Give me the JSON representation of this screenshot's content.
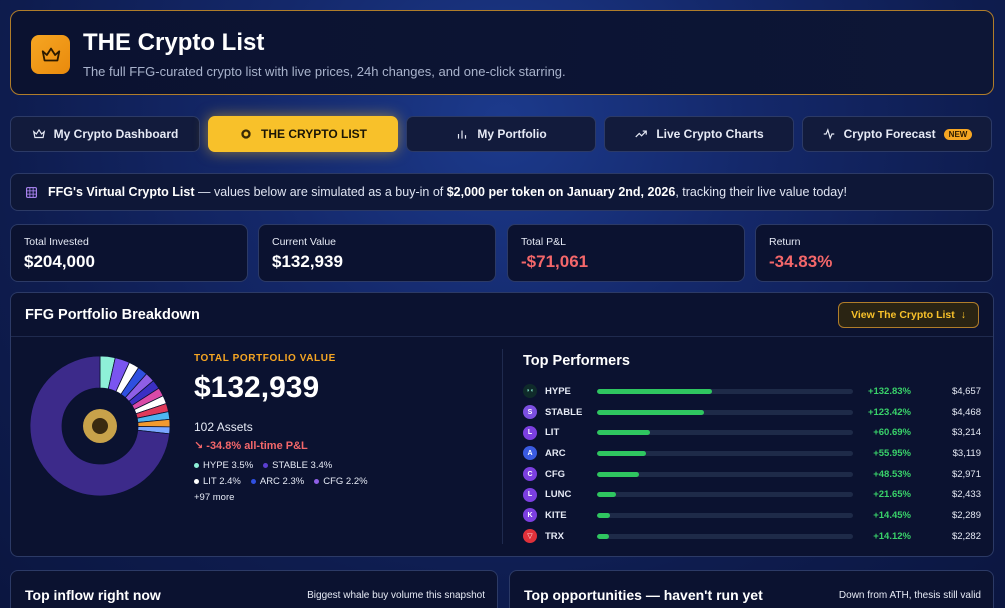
{
  "header": {
    "title": "THE Crypto List",
    "subtitle": "The full FFG-curated crypto list with live prices, 24h changes, and one-click starring.",
    "logo_icon": "crown-icon"
  },
  "tabs": [
    {
      "label": "My Crypto Dashboard",
      "icon": "crown-icon",
      "active": false
    },
    {
      "label": "THE CRYPTO LIST",
      "icon": "ffg-coin-icon",
      "active": true
    },
    {
      "label": "My Portfolio",
      "icon": "bar-chart-icon",
      "active": false
    },
    {
      "label": "Live Crypto Charts",
      "icon": "trend-up-icon",
      "active": false
    },
    {
      "label": "Crypto Forecast",
      "icon": "pulse-icon",
      "active": false,
      "badge": "NEW"
    }
  ],
  "notice": {
    "icon": "calendar-grid-icon",
    "lead": "FFG's Virtual Crypto List",
    "text_1": " — values below are simulated as a buy-in of ",
    "amount": "$2,000 per token on January 2nd, 2026",
    "text_2": ", tracking their live value today!"
  },
  "stats": [
    {
      "label": "Total Invested",
      "value": "$204,000",
      "negative": false
    },
    {
      "label": "Current Value",
      "value": "$132,939",
      "negative": false
    },
    {
      "label": "Total P&L",
      "value": "-$71,061",
      "negative": true
    },
    {
      "label": "Return",
      "value": "-34.83%",
      "negative": true
    }
  ],
  "breakdown": {
    "title": "FFG Portfolio Breakdown",
    "view_button": "View The Crypto List",
    "total_label": "TOTAL PORTFOLIO VALUE",
    "total_value": "$132,939",
    "assets": "102 Assets",
    "pnl": "-34.8% all-time P&L",
    "legend": [
      {
        "label": "HYPE 3.5%",
        "color": "#8ef0d8"
      },
      {
        "label": "STABLE 3.4%",
        "color": "#5b3fd1"
      },
      {
        "label": "LIT 2.4%",
        "color": "#ffffff"
      },
      {
        "label": "ARC 2.3%",
        "color": "#2f4fe0"
      },
      {
        "label": "CFG 2.2%",
        "color": "#8f5fe6"
      }
    ],
    "more": "+97 more",
    "donut_slices": [
      {
        "pct": 3.5,
        "color": "#8ef0d8"
      },
      {
        "pct": 3.4,
        "color": "#7a55f0"
      },
      {
        "pct": 2.4,
        "color": "#ffffff"
      },
      {
        "pct": 2.3,
        "color": "#2f4fe0"
      },
      {
        "pct": 2.2,
        "color": "#8f5fe6"
      },
      {
        "pct": 2.1,
        "color": "#3b2fc4"
      },
      {
        "pct": 2.0,
        "color": "#d94aa8"
      },
      {
        "pct": 1.9,
        "color": "#ffffff"
      },
      {
        "pct": 1.9,
        "color": "#e03a5a"
      },
      {
        "pct": 1.8,
        "color": "#4fb6f0"
      },
      {
        "pct": 1.7,
        "color": "#f29a2e"
      },
      {
        "pct": 1.6,
        "color": "#7aa7ff"
      },
      {
        "pct": 73.2,
        "color": "#3c2a8a"
      }
    ]
  },
  "top_performers": {
    "title": "Top Performers",
    "rows": [
      {
        "symbol": "HYPE",
        "change": "+132.83%",
        "value": "$4,657",
        "pct": 132.83,
        "icon": "hype-icon",
        "color": "#0f2b2a"
      },
      {
        "symbol": "STABLE",
        "change": "+123.42%",
        "value": "$4,468",
        "pct": 123.42,
        "icon": "stable-icon",
        "color": "#7c4fe0"
      },
      {
        "symbol": "LIT",
        "change": "+60.69%",
        "value": "$3,214",
        "pct": 60.69,
        "icon": "lit-icon",
        "color": "#7c3fe0"
      },
      {
        "symbol": "ARC",
        "change": "+55.95%",
        "value": "$3,119",
        "pct": 55.95,
        "icon": "arc-icon",
        "color": "#3a5be0"
      },
      {
        "symbol": "CFG",
        "change": "+48.53%",
        "value": "$2,971",
        "pct": 48.53,
        "icon": "cfg-icon",
        "color": "#7c3fe0"
      },
      {
        "symbol": "LUNC",
        "change": "+21.65%",
        "value": "$2,433",
        "pct": 21.65,
        "icon": "lunc-icon",
        "color": "#7c3fe0"
      },
      {
        "symbol": "KITE",
        "change": "+14.45%",
        "value": "$2,289",
        "pct": 14.45,
        "icon": "kite-icon",
        "color": "#7c3fe0"
      },
      {
        "symbol": "TRX",
        "change": "+14.12%",
        "value": "$2,282",
        "pct": 14.12,
        "icon": "trx-icon",
        "color": "#e0313a"
      }
    ]
  },
  "bottom": {
    "left_title": "Top inflow right now",
    "left_sub": "Biggest whale buy volume this snapshot",
    "right_title": "Top opportunities — haven't run yet",
    "right_sub": "Down from ATH, thesis still valid"
  },
  "colors": {
    "accent": "#f8c12a",
    "negative": "#f4676a",
    "positive": "#39d26a"
  }
}
